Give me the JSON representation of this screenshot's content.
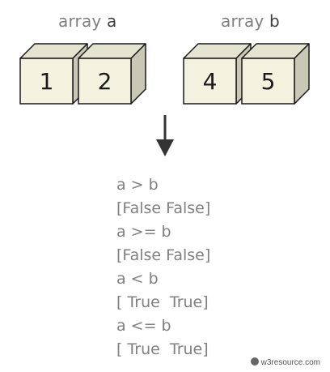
{
  "arrays": [
    {
      "prefix": "array",
      "name": "a",
      "values": [
        "1",
        "2"
      ]
    },
    {
      "prefix": "array",
      "name": "b",
      "values": [
        "4",
        "5"
      ]
    }
  ],
  "results": [
    "a > b",
    "[False False]",
    "a >= b",
    "[False False]",
    "a < b",
    "[ True  True]",
    "a <= b",
    "[ True  True]"
  ],
  "credit": "w3resource.com",
  "colors": {
    "cube_front": "#f2f2df",
    "cube_side": "#c8c8b4",
    "cube_top": "#e4e4d0",
    "stroke": "#1a1a1a",
    "arrow": "#333333",
    "label_gray": "#808080"
  },
  "icons": {
    "arrow": "down-arrow-icon"
  }
}
